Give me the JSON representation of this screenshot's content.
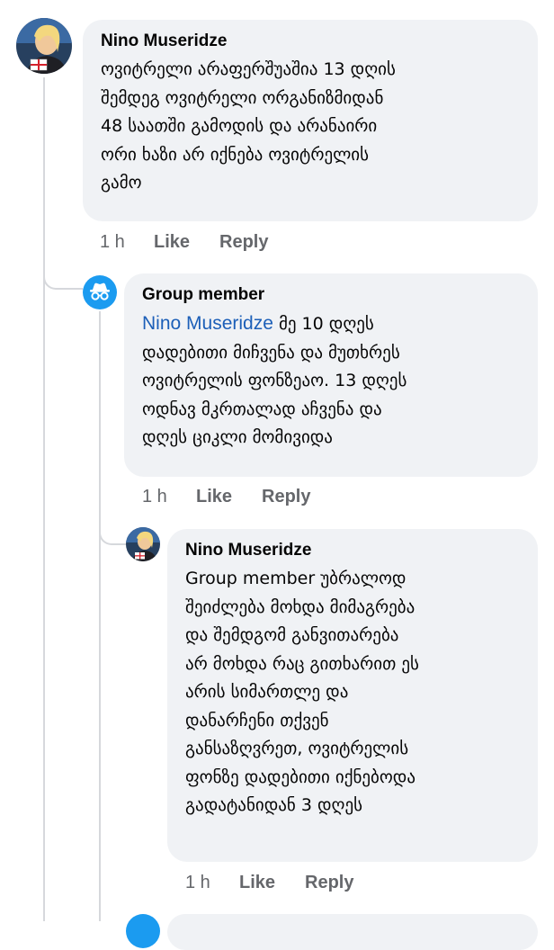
{
  "comments": [
    {
      "author": "Nino Museridze",
      "mention": "",
      "text": "ოვიტრელი არაფერშუაშია 13 დღის\nშემდეგ ოვიტრელი ორგანიზმიდან\n48 საათში გამოდის და არანაირი\nორი ხაზი არ იქნება ოვიტრელის\nგამო",
      "time": "1 h",
      "like_label": "Like",
      "reply_label": "Reply"
    },
    {
      "author": "Group member",
      "mention": "Nino Museridze",
      "text": " მე 10 დღეს\nდადებითი მიჩვენა და მუთხრეს\nოვიტრელის ფონზეაო. 13 დღეს\nოდნავ მკრთალად აჩვენა და\nდღეს ციკლი მომივიდა",
      "time": "1 h",
      "like_label": "Like",
      "reply_label": "Reply"
    },
    {
      "author": "Nino Museridze",
      "mention": "",
      "text": "Group member უბრალოდ\nშეიძლება მოხდა მიმაგრება\nდა შემდგომ განვითარება\nარ მოხდა რაც გითხარით ეს\nარის სიმართლე და\nდანარჩენი თქვენ\nგანსაზღვრეთ, ოვიტრელის\nფონზე დადებითი იქნებოდა\nგადატანიდან 3 დღეს",
      "time": "1 h",
      "like_label": "Like",
      "reply_label": "Reply"
    }
  ],
  "colors": {
    "mention": "#1c5fb8",
    "anonymous_avatar": "#1b9bf0",
    "meta_text": "#65676b",
    "bubble": "#f0f2f5"
  },
  "icons": {
    "anonymous_avatar": "incognito-icon"
  }
}
